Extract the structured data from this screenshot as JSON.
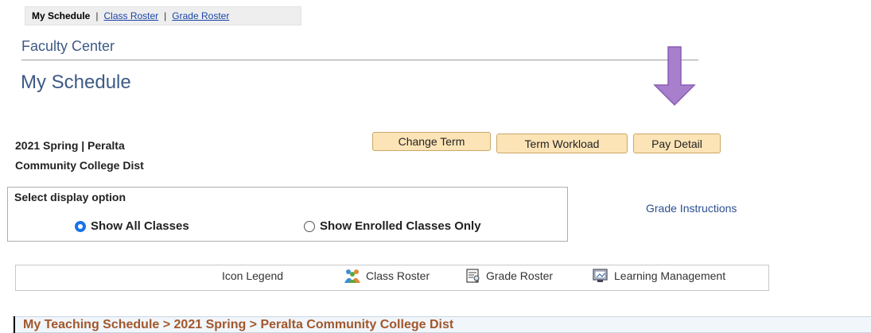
{
  "topnav": {
    "current": "My Schedule",
    "separator": "|",
    "class_roster": "Class Roster",
    "grade_roster": "Grade Roster"
  },
  "header": {
    "faculty_center": "Faculty Center",
    "page_title": "My Schedule"
  },
  "term": {
    "line1": "2021 Spring | Peralta",
    "line2": "Community College Dist"
  },
  "buttons": {
    "change_term": "Change Term",
    "term_workload": "Term Workload",
    "pay_detail": "Pay Detail"
  },
  "display_option": {
    "label": "Select display option",
    "options": [
      {
        "label": "Show All Classes",
        "selected": true
      },
      {
        "label": "Show Enrolled Classes Only",
        "selected": false
      }
    ]
  },
  "links": {
    "grade_instructions": "Grade Instructions"
  },
  "legend": {
    "title": "Icon Legend",
    "items": [
      {
        "label": "Class Roster",
        "icon": "class-roster-icon"
      },
      {
        "label": "Grade Roster",
        "icon": "grade-roster-icon"
      },
      {
        "label": "Learning Management",
        "icon": "learning-management-icon"
      }
    ]
  },
  "teaching_schedule": {
    "title": "My Teaching Schedule > 2021 Spring > Peralta Community College Dist"
  },
  "colors": {
    "button_bg": "#fde4b7",
    "button_border": "#c9a866",
    "header_blue": "#3d5a85",
    "link_blue": "#1a44a8",
    "arrow_purple": "#a77fcd",
    "teach_title": "#a2572b"
  }
}
